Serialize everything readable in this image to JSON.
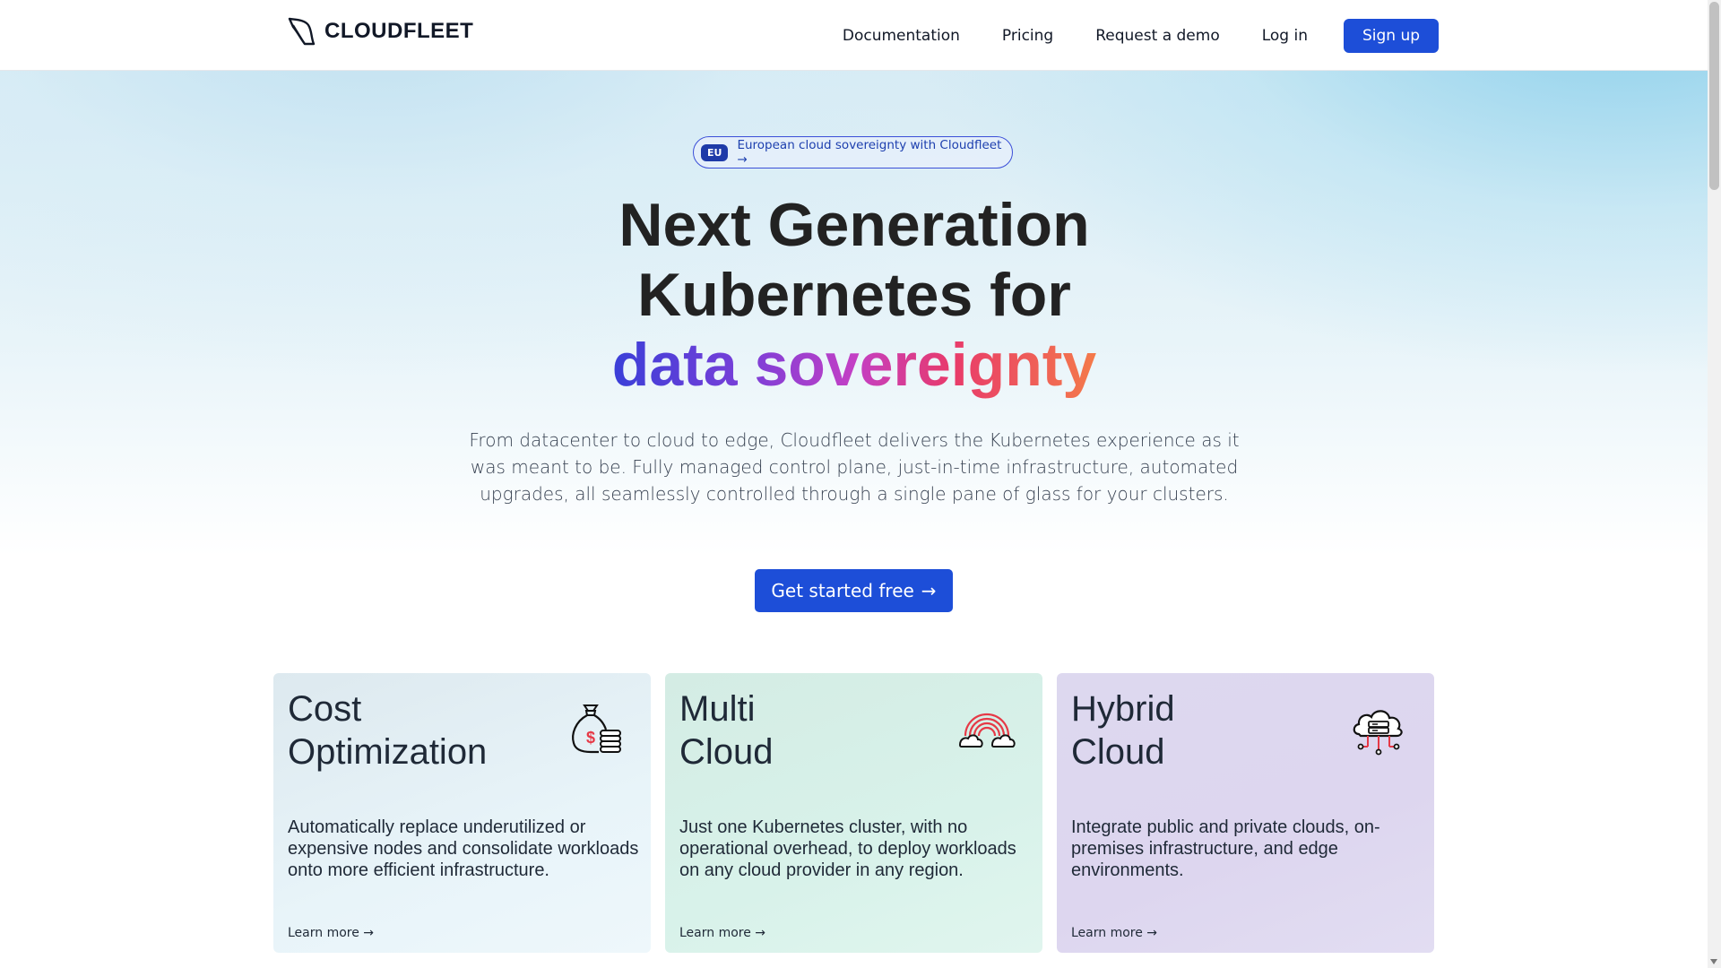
{
  "header": {
    "brand": "CLOUDFLEET",
    "nav": [
      {
        "label": "Documentation"
      },
      {
        "label": "Pricing"
      },
      {
        "label": "Request a demo"
      },
      {
        "label": "Log in"
      }
    ],
    "signup_label": "Sign up"
  },
  "hero": {
    "pill_tag": "EU",
    "pill_text": "European cloud sovereignty with Cloudfleet →",
    "title_line1": "Next Generation",
    "title_line2": "Kubernetes for",
    "title_line3": "data sovereignty",
    "subtitle": "From datacenter to cloud to edge, Cloudfleet delivers the Kubernetes experience as it was meant to be. Fully managed control plane, just-in-time infrastructure, automated upgrades, all seamlessly controlled through a single pane of glass for your clusters.",
    "cta_label": "Get started free",
    "cta_arrow": "→"
  },
  "cards": [
    {
      "title_line1": "Cost",
      "title_line2": "Optimization",
      "description": "Automatically replace underutilized or expensive nodes and consolidate workloads onto more efficient infrastructure.",
      "link": "Learn more →",
      "icon": "money-bag-coins-icon"
    },
    {
      "title_line1": "Multi",
      "title_line2": "Cloud",
      "description": "Just one Kubernetes cluster, with no operational overhead, to deploy workloads on any cloud provider in any region.",
      "link": "Learn more →",
      "icon": "rainbow-clouds-icon"
    },
    {
      "title_line1": "Hybrid",
      "title_line2": "Cloud",
      "description": "Integrate public and private clouds, on-premises infrastructure, and edge environments.",
      "link": "Learn more →",
      "icon": "cloud-server-icon"
    }
  ],
  "colors": {
    "primary": "#1d4ed8",
    "gradient_start": "#3a3fd8",
    "gradient_end": "#f47a4a",
    "icon_accent": "#e63946"
  }
}
